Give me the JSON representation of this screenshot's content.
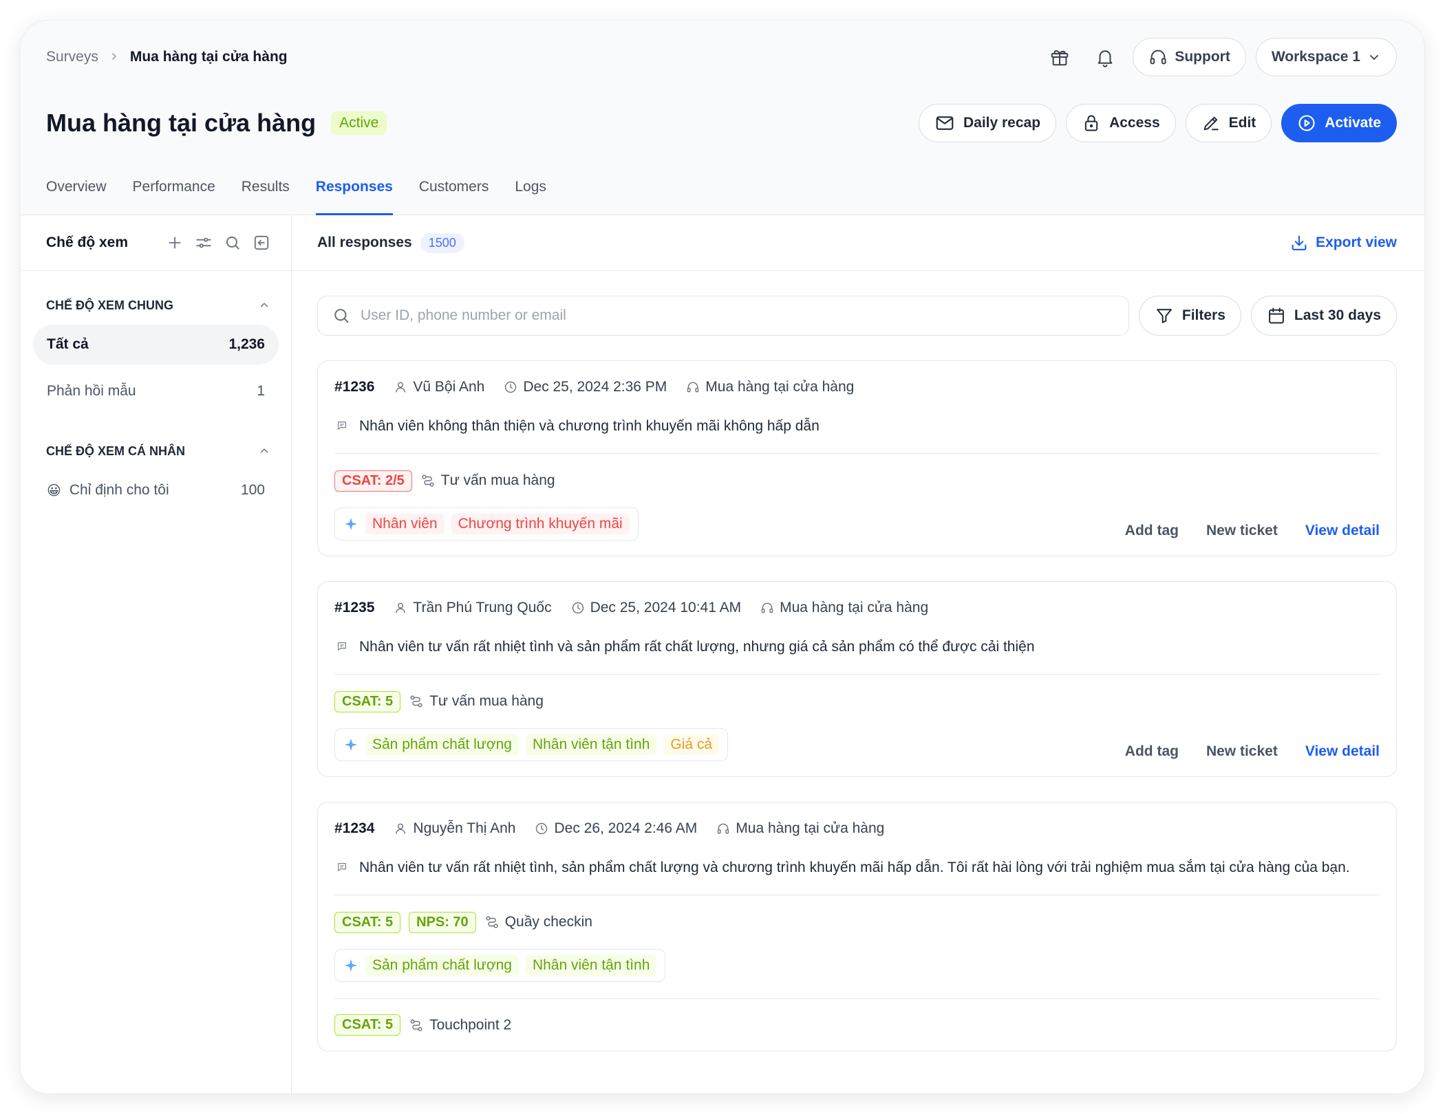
{
  "breadcrumb": {
    "root": "Surveys",
    "current": "Mua hàng tại cửa hàng"
  },
  "top_actions": {
    "support": "Support",
    "workspace": "Workspace 1"
  },
  "header": {
    "title": "Mua hàng tại cửa hàng",
    "status": "Active",
    "buttons": {
      "daily_recap": "Daily recap",
      "access": "Access",
      "edit": "Edit",
      "activate": "Activate"
    }
  },
  "tabs": [
    "Overview",
    "Performance",
    "Results",
    "Responses",
    "Customers",
    "Logs"
  ],
  "sidebar": {
    "title": "Chế độ xem",
    "shared_group": "CHẾ ĐỘ XEM CHUNG",
    "shared_items": [
      {
        "label": "Tất cả",
        "count": "1,236"
      },
      {
        "label": "Phản hồi mẫu",
        "count": "1"
      }
    ],
    "personal_group": "CHẾ ĐỘ XEM CÁ NHÂN",
    "personal_items": [
      {
        "emoji": "😀",
        "label": "Chỉ định cho tôi",
        "count": "100"
      }
    ]
  },
  "main": {
    "title": "All responses",
    "count": "1500",
    "export": "Export view",
    "search_placeholder": "User ID, phone number or email",
    "filters": "Filters",
    "date_range": "Last 30 days"
  },
  "card_actions": {
    "add_tag": "Add tag",
    "new_ticket": "New ticket",
    "view_detail": "View detail"
  },
  "responses": [
    {
      "id": "#1236",
      "user": "Vũ Bội Anh",
      "time": "Dec 25, 2024 2:36 PM",
      "survey": "Mua hàng tại cửa hàng",
      "comment": "Nhân viên không thân thiện và chương trình khuyến mãi không hấp dẫn",
      "scores": [
        "CSAT: 2/5"
      ],
      "touchpoint": "Tư vấn mua hàng",
      "tags": [
        "Nhân viên",
        "Chương trình khuyến mãi"
      ]
    },
    {
      "id": "#1235",
      "user": "Trần Phú Trung Quốc",
      "time": "Dec 25, 2024 10:41 AM",
      "survey": "Mua hàng tại cửa hàng",
      "comment": "Nhân viên tư vấn rất nhiệt tình và sản phẩm rất chất lượng, nhưng giá cả sản phẩm có thể được cải thiện",
      "scores": [
        "CSAT: 5"
      ],
      "touchpoint": "Tư vấn mua hàng",
      "tags": [
        "Sản phẩm chất lượng",
        "Nhân viên tận tình",
        "Giá cả"
      ]
    },
    {
      "id": "#1234",
      "user": "Nguyễn Thị Anh",
      "time": "Dec 26, 2024 2:46 AM",
      "survey": "Mua hàng tại cửa hàng",
      "comment": "Nhân viên tư vấn rất nhiệt tình, sản phẩm chất lượng và chương trình khuyến mãi hấp dẫn. Tôi rất hài lòng với trải nghiệm mua sắm tại cửa hàng của bạn.",
      "scores": [
        "CSAT: 5",
        "NPS: 70"
      ],
      "touchpoint": "Quầy checkin",
      "tags": [
        "Sản phẩm chất lượng",
        "Nhân viên tận tình"
      ],
      "extra_score": "CSAT: 5",
      "extra_touchpoint": "Touchpoint 2"
    }
  ],
  "colors": {
    "accent": "#1d5ef0",
    "negative": "#ef4444",
    "positive": "#65a30d",
    "neutral": "#ea9a1f"
  }
}
